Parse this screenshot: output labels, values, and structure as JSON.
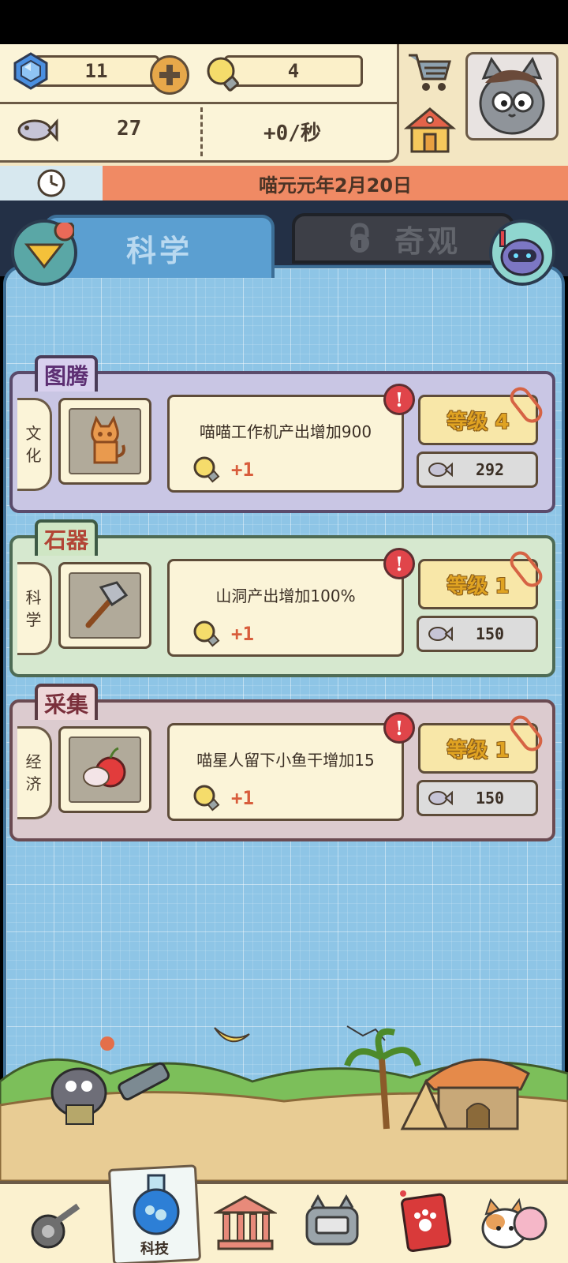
{
  "resources": {
    "gems": "11",
    "bulbs": "4",
    "fish": "27",
    "rate": "+0/秒"
  },
  "date": "喵元元年2月20日",
  "tabs": {
    "science": "科学",
    "wonders": "奇观"
  },
  "cards": [
    {
      "title": "图腾",
      "category": [
        "文",
        "化"
      ],
      "description": "喵喵工作机产出增加900",
      "reward": "+1",
      "level": "等级 4",
      "cost": "292",
      "info": "!",
      "theme": "#c9c6e4",
      "title_color": "#d8d0ee"
    },
    {
      "title": "石器",
      "category": [
        "科",
        "学"
      ],
      "description": "山洞产出增加100%",
      "reward": "+1",
      "level": "等级 1",
      "cost": "150",
      "info": "!",
      "theme": "#d6e8cf",
      "title_color": "#cfe6c4"
    },
    {
      "title": "采集",
      "category": [
        "经",
        "济"
      ],
      "description": "喵星人留下小鱼干增加15",
      "reward": "+1",
      "level": "等级 1",
      "cost": "150",
      "info": "!",
      "theme": "#dccbcf",
      "title_color": "#eed7d9"
    }
  ],
  "nav": {
    "active_label": "科技"
  },
  "colors": {
    "accent_orange": "#f08a64",
    "board_blue": "#8ec5e6",
    "info_red": "#e0454a",
    "level_gold": "#e0a322"
  }
}
